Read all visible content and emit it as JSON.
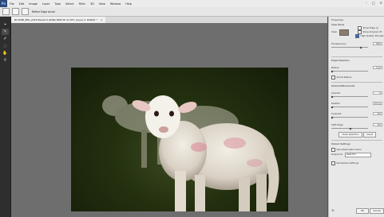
{
  "app": {
    "logo": "Ps"
  },
  "menu": [
    "File",
    "Edit",
    "Image",
    "Layer",
    "Type",
    "Select",
    "Filter",
    "3D",
    "View",
    "Window",
    "Help"
  ],
  "window_controls": [
    "–",
    "□",
    "✕"
  ],
  "options_bar": {
    "label": "Refine Edge brush"
  },
  "document_tab": {
    "title": "BC-EWB_BSS_2018 Bluebird_BOBA BOB SE at 20% (Layer 0, RGB/8) *",
    "close": "×"
  },
  "panel": {
    "title": "Properties",
    "view_mode_label": "View Mode",
    "view_label": "View:",
    "show_edge": "Show Edge (J)",
    "show_original": "Show Original (P)",
    "high_quality": "High Quality Preview",
    "transparency_label": "Transparency",
    "transparency_value": "80%",
    "edge_detection": "Edge Detection",
    "radius_label": "Radius:",
    "radius_value": "0 px",
    "smart_radius": "Smart Radius",
    "global_refinements": "Global Refinements",
    "smooth_label": "Smooth:",
    "smooth_value": "0",
    "feather_label": "Feather:",
    "feather_value": "0.0 px",
    "contrast_label": "Contrast:",
    "contrast_value": "0%",
    "shift_edge_label": "Shift Edge:",
    "shift_edge_value": "0%",
    "clear_selection": "Clear Selection",
    "invert": "Invert",
    "output_settings": "Output Settings",
    "decontaminate": "Decontaminate Colors",
    "output_to_label": "Output To:",
    "output_to_value": "Selection",
    "remember": "Remember Settings",
    "ok": "OK",
    "cancel": "Cancel"
  },
  "colors": {
    "accent": "#2d6bd6",
    "canvas": "#6e6e6e",
    "toolbar": "#2e2e2e",
    "panel": "#e8e8e8"
  }
}
